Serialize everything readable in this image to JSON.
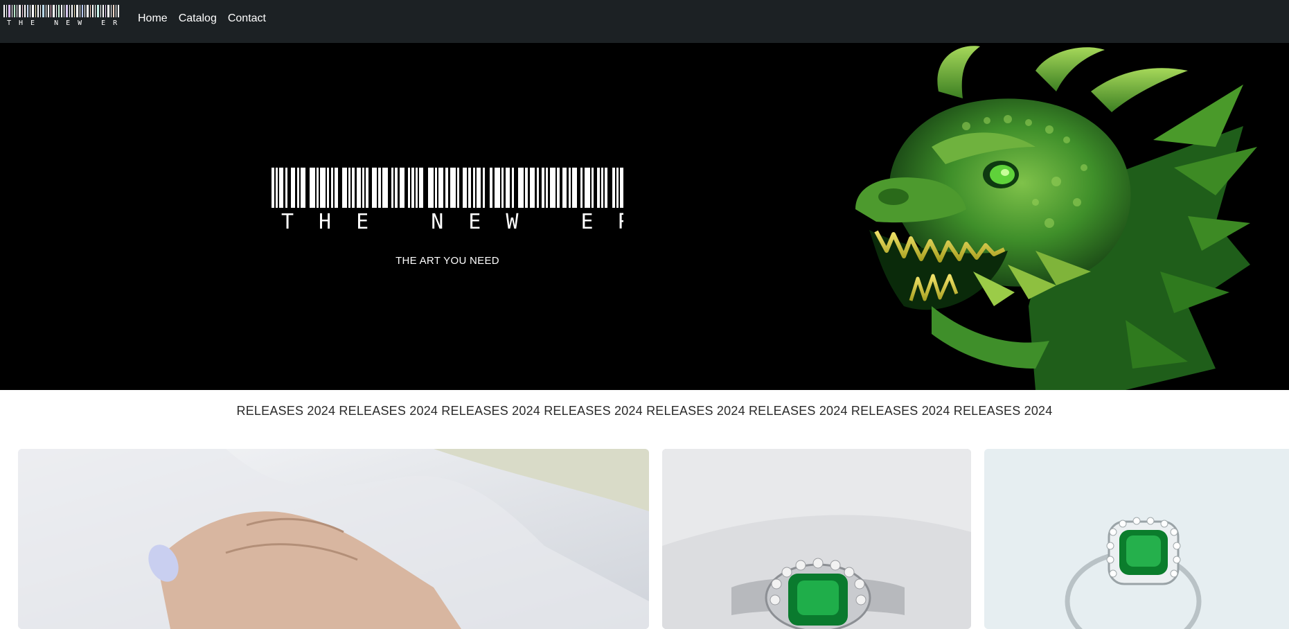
{
  "brand": {
    "name": "THE NEW ERA",
    "tagline": "THE ART YOU NEED"
  },
  "nav": {
    "items": [
      {
        "label": "Home"
      },
      {
        "label": "Catalog"
      },
      {
        "label": "Contact"
      }
    ]
  },
  "marquee": {
    "text": "RELEASES 2024 RELEASES 2024 RELEASES 2024 RELEASES 2024 RELEASES 2024 RELEASES 2024 RELEASES 2024 RELEASES 2024"
  },
  "colors": {
    "navbar_bg": "#1c2124",
    "hero_bg": "#000000",
    "accent_green": "#2f8f2a",
    "emerald": "#0a7a2e"
  },
  "icons": {
    "logo": "barcode-logo",
    "hero_art": "green-dragon-head"
  }
}
